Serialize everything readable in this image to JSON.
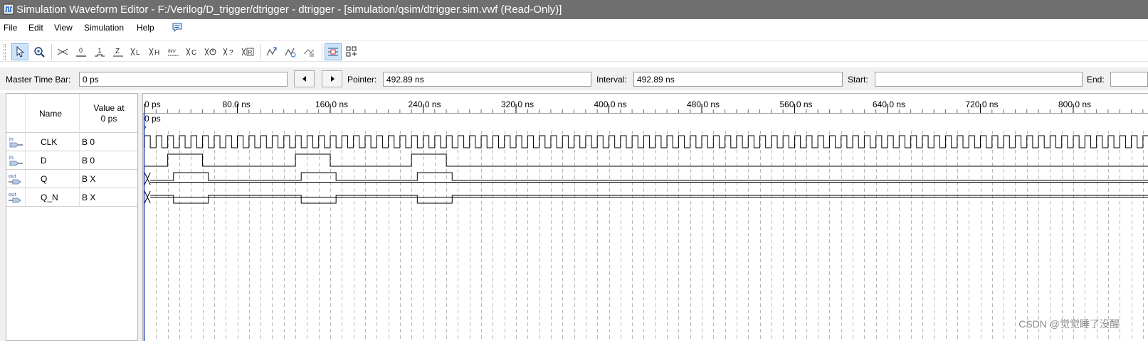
{
  "window": {
    "title": "Simulation Waveform Editor - F:/Verilog/D_trigger/dtrigger - dtrigger - [simulation/qsim/dtrigger.sim.vwf (Read-Only)]"
  },
  "menu": {
    "file": "File",
    "edit": "Edit",
    "view": "View",
    "simulation": "Simulation",
    "help": "Help",
    "extra_icon": "comment-icon"
  },
  "toolbar": {
    "buttons": [
      {
        "name": "selection-tool",
        "icon": "arrow-pointer-icon",
        "active": true
      },
      {
        "name": "zoom-tool",
        "icon": "magnifier-icon",
        "active": false
      },
      {
        "name": "forcing-unknown",
        "icon": "unknown-x-icon",
        "text": "X"
      },
      {
        "name": "forcing-low",
        "icon": "forcing-low-icon",
        "text": "0"
      },
      {
        "name": "forcing-high",
        "icon": "forcing-high-icon",
        "text": "1"
      },
      {
        "name": "high-impedance",
        "icon": "high-impedance-icon",
        "text": "Z"
      },
      {
        "name": "weak-low",
        "icon": "weak-low-icon",
        "text": "L"
      },
      {
        "name": "weak-high",
        "icon": "weak-high-icon",
        "text": "H"
      },
      {
        "name": "invert",
        "icon": "invert-icon",
        "text": "INV"
      },
      {
        "name": "count-value",
        "icon": "count-value-icon",
        "text": "C"
      },
      {
        "name": "clock-value",
        "icon": "clock-value-icon",
        "text": "O"
      },
      {
        "name": "arbitrary-value",
        "icon": "arbitrary-value-icon",
        "text": "?"
      },
      {
        "name": "random-value",
        "icon": "random-value-icon",
        "text": "R"
      },
      {
        "name": "functional-simulation",
        "icon": "run-functional-icon"
      },
      {
        "name": "timing-simulation",
        "icon": "run-timing-icon"
      },
      {
        "name": "generate-netlist",
        "icon": "netlist-icon"
      },
      {
        "name": "snap-to-grid",
        "icon": "snap-grid-icon",
        "active": true
      },
      {
        "name": "node-finder",
        "icon": "node-finder-icon"
      }
    ]
  },
  "timebar": {
    "master_label": "Master Time Bar:",
    "master_value": "0 ps",
    "pointer_label": "Pointer:",
    "pointer_value": "492.89 ns",
    "interval_label": "Interval:",
    "interval_value": "492.89 ns",
    "start_label": "Start:",
    "start_value": "",
    "end_label": "End:",
    "end_value": ""
  },
  "signals": {
    "header_name": "Name",
    "header_value_line1": "Value at",
    "header_value_line2": "0 ps",
    "rows": [
      {
        "name": "CLK",
        "value": "B 0",
        "direction": "in"
      },
      {
        "name": "D",
        "value": "B 0",
        "direction": "in"
      },
      {
        "name": "Q",
        "value": "B X",
        "direction": "out"
      },
      {
        "name": "Q_N",
        "value": "B X",
        "direction": "out"
      }
    ]
  },
  "timeline": {
    "cursor_label": "0 ps",
    "ticks": [
      "0 ps",
      "80.0 ns",
      "160.0 ns",
      "240.0 ns",
      "320.0 ns",
      "400.0 ns",
      "480.0 ns",
      "560.0 ns",
      "640.0 ns",
      "720.0 ns",
      "800.0 ns"
    ],
    "clock_period_ns": 10,
    "d_pulses_ns": [
      [
        20,
        50
      ],
      [
        130,
        160
      ],
      [
        230,
        260
      ]
    ],
    "q_pulses_ns": [
      [
        25,
        55
      ],
      [
        135,
        165
      ],
      [
        235,
        265
      ]
    ],
    "q_unknown_until_ns": 5
  },
  "watermark": "CSDN @觉觉睡了没醒"
}
